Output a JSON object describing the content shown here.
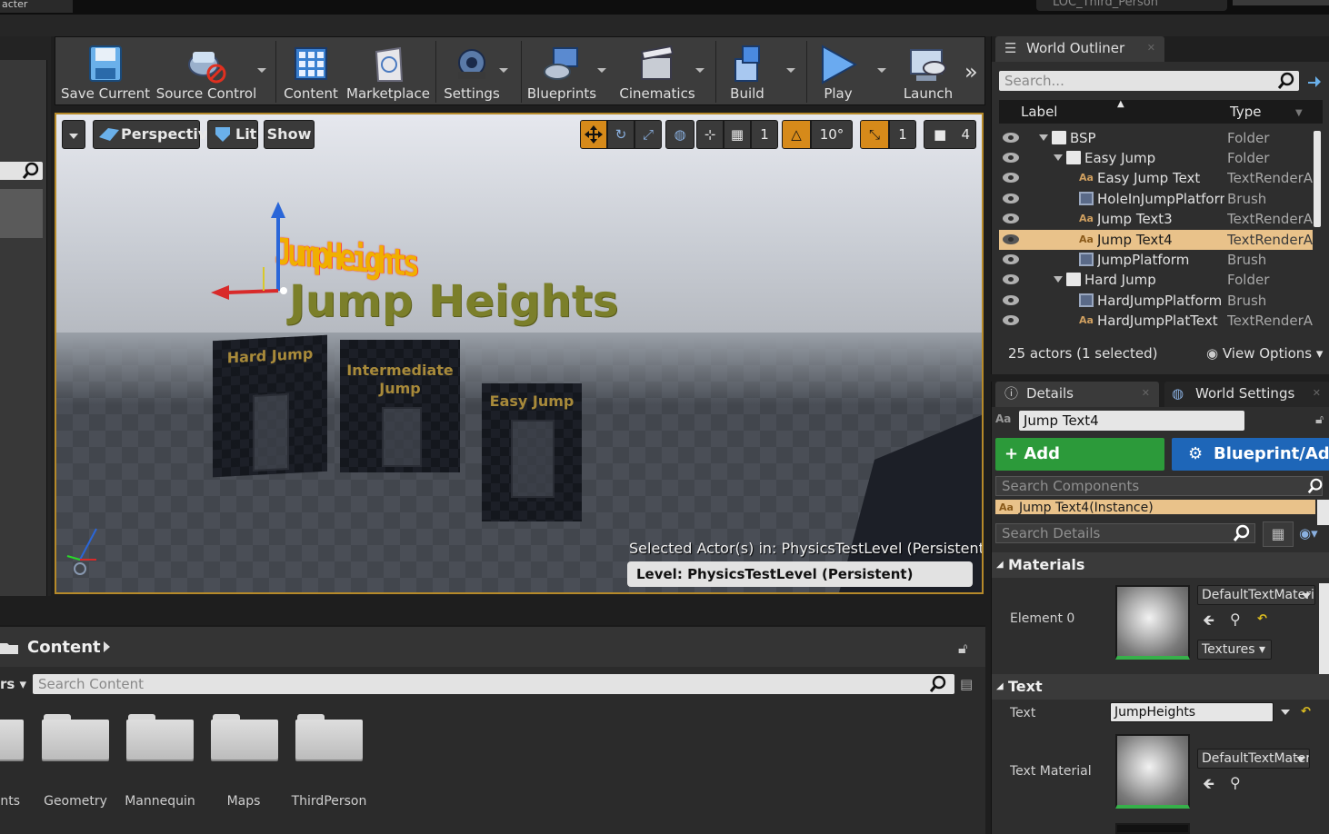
{
  "window": {
    "left_tab_title": "acter",
    "project_title": "LOC_Third_Person"
  },
  "toolbar": {
    "items": [
      {
        "label": "Save Current",
        "icon": "save-icon"
      },
      {
        "label": "Source Control",
        "icon": "source-control-icon"
      },
      {
        "label": "Content",
        "icon": "content-icon"
      },
      {
        "label": "Marketplace",
        "icon": "marketplace-icon"
      },
      {
        "label": "Settings",
        "icon": "settings-icon"
      },
      {
        "label": "Blueprints",
        "icon": "blueprints-icon"
      },
      {
        "label": "Cinematics",
        "icon": "cinematics-icon"
      },
      {
        "label": "Build",
        "icon": "build-icon"
      },
      {
        "label": "Play",
        "icon": "play-icon"
      },
      {
        "label": "Launch",
        "icon": "launch-icon"
      }
    ],
    "overflow": "»"
  },
  "viewport": {
    "perspective_label": "Perspective",
    "lit_label": "Lit",
    "show_label": "Show",
    "grid_snap_value": "1",
    "rotation_snap_value": "10°",
    "scale_snap_value": "1",
    "camera_speed_value": "4",
    "scene": {
      "selected_text": "JumpHeights",
      "title_text": "Jump Heights",
      "wall_hard": "Hard Jump",
      "wall_intermediate": "Intermediate Jump",
      "wall_easy": "Easy Jump"
    },
    "selected_actor_label": "Selected Actor(s) in:",
    "selected_actor_level": "PhysicsTestLevel (Persistent)",
    "level_label": "Level:",
    "level_value": "PhysicsTestLevel (Persistent)"
  },
  "content_browser": {
    "title": "Content",
    "search_placeholder": "Search Content",
    "filters_label": "rs",
    "folders": [
      {
        "name": "nts"
      },
      {
        "name": "Geometry"
      },
      {
        "name": "Mannequin"
      },
      {
        "name": "Maps"
      },
      {
        "name": "ThirdPerson"
      }
    ]
  },
  "outliner": {
    "tab_title": "World Outliner",
    "search_placeholder": "Search...",
    "col_label": "Label",
    "col_type": "Type",
    "rows": [
      {
        "name": "BSP",
        "type": "Folder"
      },
      {
        "name": "Easy Jump",
        "type": "Folder"
      },
      {
        "name": "Easy Jump Text",
        "type": "TextRenderActor"
      },
      {
        "name": "HoleInJumpPlatform",
        "type": "Brush"
      },
      {
        "name": "Jump Text3",
        "type": "TextRenderActor"
      },
      {
        "name": "Jump Text4",
        "type": "TextRenderActor"
      },
      {
        "name": "JumpPlatform",
        "type": "Brush"
      },
      {
        "name": "Hard Jump",
        "type": "Folder"
      },
      {
        "name": "HardJumpPlatform",
        "type": "Brush"
      },
      {
        "name": "HardJumpPlatText",
        "type": "TextRenderActor"
      }
    ],
    "footer_count": "25 actors (1 selected)",
    "view_options": "View Options"
  },
  "details": {
    "tab_details": "Details",
    "tab_world_settings": "World Settings",
    "actor_name": "Jump Text4",
    "add_component": "+ Add Component",
    "blueprint_add": "Blueprint/Add",
    "search_components_placeholder": "Search Components",
    "instance_label": "Jump Text4(Instance)",
    "search_details_placeholder": "Search Details",
    "materials_section": "Materials",
    "element0_label": "Element 0",
    "element0_material": "DefaultTextMaterial",
    "textures_label": "Textures",
    "text_section": "Text",
    "text_label": "Text",
    "text_value": "JumpHeights",
    "text_material_label": "Text Material",
    "text_material_value": "DefaultTextMaterial"
  }
}
